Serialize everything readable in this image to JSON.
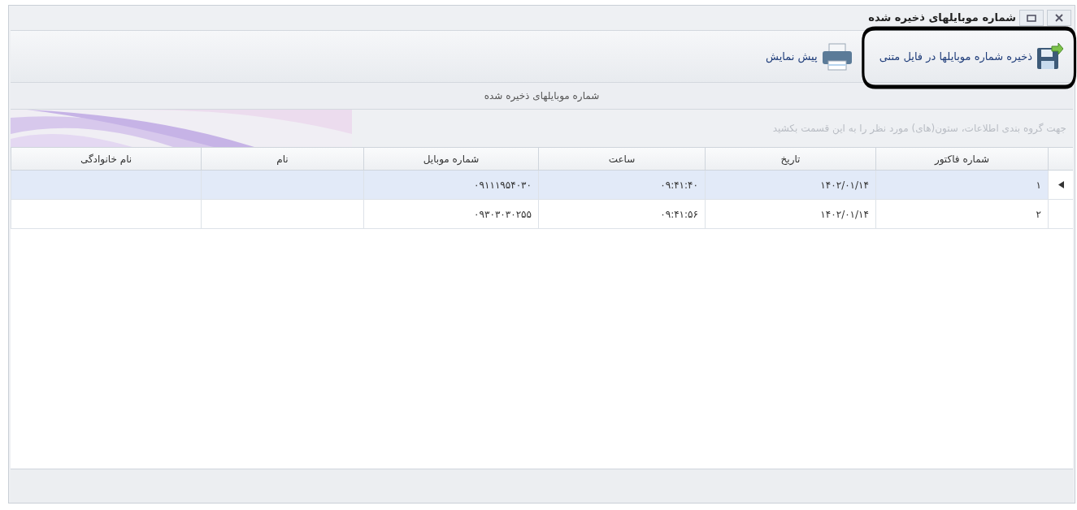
{
  "window": {
    "title": "شماره موبایلهای ذخیره شده"
  },
  "toolbar": [
    {
      "kind": "save",
      "label": "ذخیره شماره موبایلها در فایل متنی",
      "highlighted": true
    },
    {
      "kind": "print",
      "label": "پیش نمایش",
      "highlighted": false
    }
  ],
  "grid": {
    "caption": "شماره موبایلهای ذخیره شده",
    "group_hint": "جهت گروه بندی اطلاعات، ستون(های) مورد نظر را به این قسمت بکشید",
    "columns": [
      "شماره فاکتور",
      "تاریخ",
      "ساعت",
      "شماره موبایل",
      "نام",
      "نام خانوادگی"
    ],
    "rows": [
      {
        "selected": true,
        "cells": [
          "۱",
          "۱۴۰۲/۰۱/۱۴",
          "۰۹:۴۱:۴۰",
          "۰۹۱۱۱۹۵۴۰۳۰",
          "",
          ""
        ]
      },
      {
        "selected": false,
        "cells": [
          "۲",
          "۱۴۰۲/۰۱/۱۴",
          "۰۹:۴۱:۵۶",
          "۰۹۳۰۳۰۳۰۲۵۵",
          "",
          ""
        ]
      }
    ]
  }
}
